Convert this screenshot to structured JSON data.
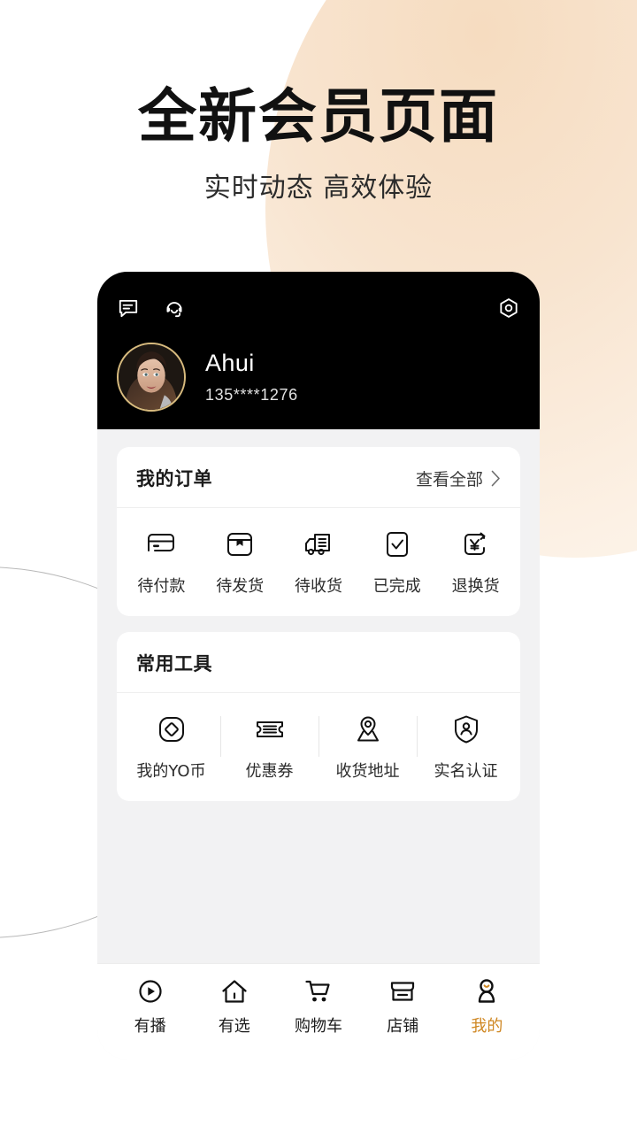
{
  "promo": {
    "headline": "全新会员页面",
    "subhead": "实时动态 高效体验"
  },
  "theme": {
    "page_bg": "#ffffff",
    "blob": "#f7e2ca",
    "phone_bg": "#f2f2f3",
    "header_bg": "#000000",
    "card_bg": "#ffffff",
    "accent": "#cf8722",
    "avatar_ring": "#d8bb7e",
    "text_primary": "#1b1b1b",
    "divider": "#eeeeee"
  },
  "phone": {
    "header": {
      "icons": [
        {
          "name": "message-icon",
          "label": "消息"
        },
        {
          "name": "headset-icon",
          "label": "客服"
        }
      ],
      "settings_icon": {
        "name": "settings-icon",
        "label": "设置"
      },
      "profile": {
        "avatar_name": "user-avatar",
        "username": "Ahui",
        "phone": "135****1276"
      }
    },
    "orders_card": {
      "title": "我的订单",
      "more_label": "查看全部",
      "items": [
        {
          "icon": "credit-card-icon",
          "label": "待付款"
        },
        {
          "icon": "package-box-icon",
          "label": "待发货"
        },
        {
          "icon": "delivery-truck-icon",
          "label": "待收货"
        },
        {
          "icon": "checkbox-check-icon",
          "label": "已完成"
        },
        {
          "icon": "refund-yen-icon",
          "label": "退换货"
        }
      ]
    },
    "tools_card": {
      "title": "常用工具",
      "items": [
        {
          "icon": "coin-diamond-icon",
          "label": "我的YO币"
        },
        {
          "icon": "ticket-coupon-icon",
          "label": "优惠券"
        },
        {
          "icon": "map-pin-icon",
          "label": "收货地址"
        },
        {
          "icon": "shield-person-icon",
          "label": "实名认证"
        }
      ]
    },
    "bottom_nav": {
      "active_index": 4,
      "items": [
        {
          "icon": "play-circle-icon",
          "label": "有播"
        },
        {
          "icon": "home-icon",
          "label": "有选"
        },
        {
          "icon": "shopping-cart-icon",
          "label": "购物车"
        },
        {
          "icon": "store-icon",
          "label": "店铺"
        },
        {
          "icon": "person-icon",
          "label": "我的"
        }
      ]
    }
  }
}
